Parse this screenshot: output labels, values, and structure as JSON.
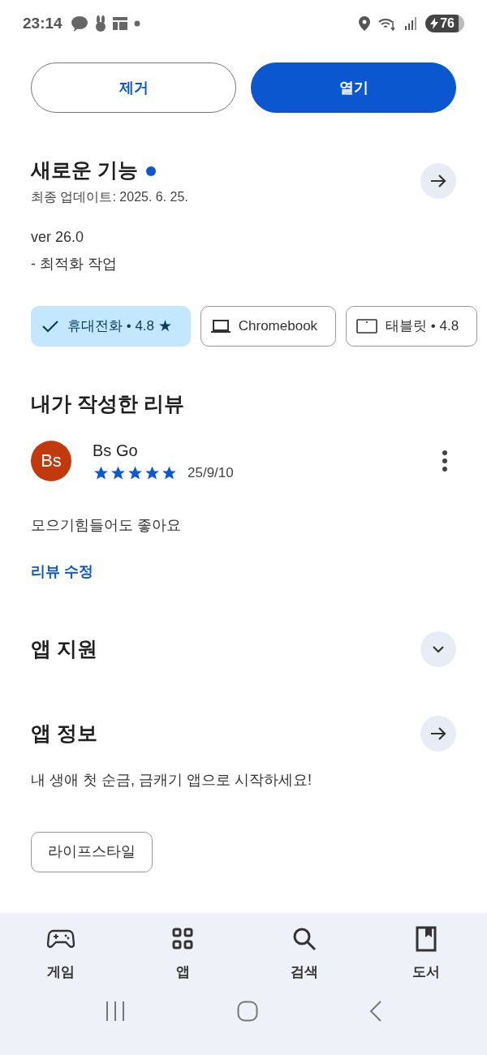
{
  "status_bar": {
    "time": "23:14",
    "battery": "76"
  },
  "actions": [
    {
      "label": "제거",
      "kind": "outline"
    },
    {
      "label": "열기",
      "kind": "filled"
    }
  ],
  "whats_new": {
    "title": "새로운 기능",
    "unread": true,
    "updated": "최종 업데이트: 2025. 6. 25.",
    "notes": [
      "ver 26.0",
      "- 최적화 작업"
    ]
  },
  "device_chips": [
    {
      "label": "휴대전화 • 4.8 ★",
      "selected": true
    },
    {
      "label": "Chromebook",
      "kind": "laptop",
      "selected": false
    },
    {
      "label": "태블릿 • 4.8",
      "kind": "tablet",
      "selected": false
    }
  ],
  "my_review": {
    "heading": "내가 작성한 리뷰",
    "avatar": "Bs",
    "author": "Bs Go",
    "stars": 5,
    "date": "25/9/10",
    "text": "모으기힘들어도 좋아요",
    "edit_link": "리뷰 수정"
  },
  "app_support": {
    "title": "앱 지원",
    "expanded": false
  },
  "app_info": {
    "title": "앱 정보",
    "description": "내 생애 첫 순금, 금캐기 앱으로 시작하세요!",
    "tag": "라이프스타일"
  },
  "bottom_nav": [
    {
      "label": "게임",
      "kind": "games",
      "selected": false
    },
    {
      "label": "앱",
      "kind": "apps",
      "selected": false
    },
    {
      "label": "검색",
      "kind": "search",
      "selected": false
    },
    {
      "label": "도서",
      "kind": "books",
      "selected": false
    }
  ]
}
